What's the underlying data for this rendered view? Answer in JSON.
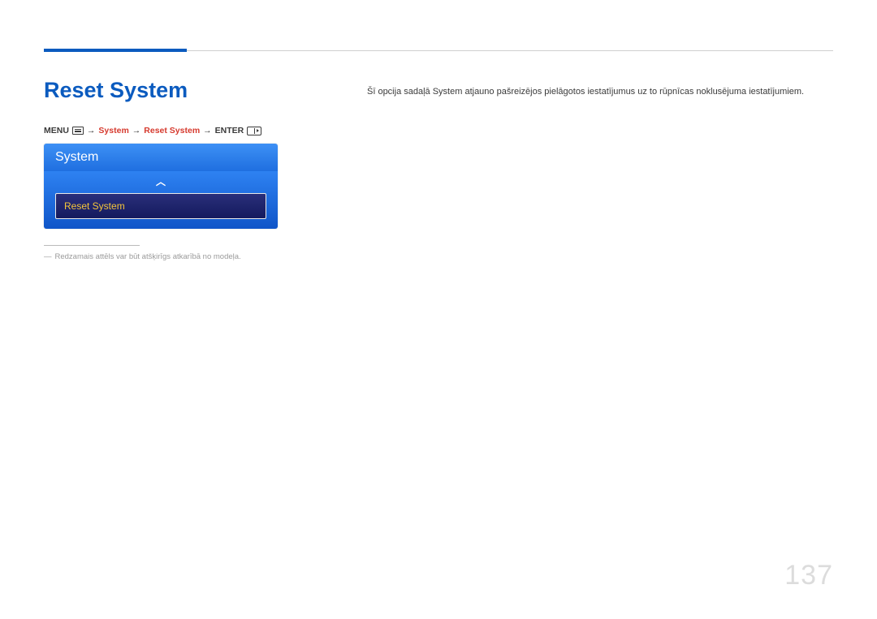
{
  "page_number": "137",
  "heading": "Reset System",
  "breadcrumb": {
    "menu_label": "MENU",
    "menu_icon": "menu-icon",
    "arrow": "→",
    "path1": "System",
    "path2": "Reset System",
    "enter_label": "ENTER",
    "enter_icon": "enter-icon"
  },
  "osd": {
    "header": "System",
    "caret": "︿",
    "selected_item": "Reset System"
  },
  "footnote": {
    "dash": "―",
    "text": "Redzamais attēls var būt atšķirīgs atkarībā no modeļa."
  },
  "description": "Šī opcija sadaļā System atjauno pašreizējos pielāgotos iestatījumus uz to rūpnīcas noklusējuma iestatījumiem."
}
